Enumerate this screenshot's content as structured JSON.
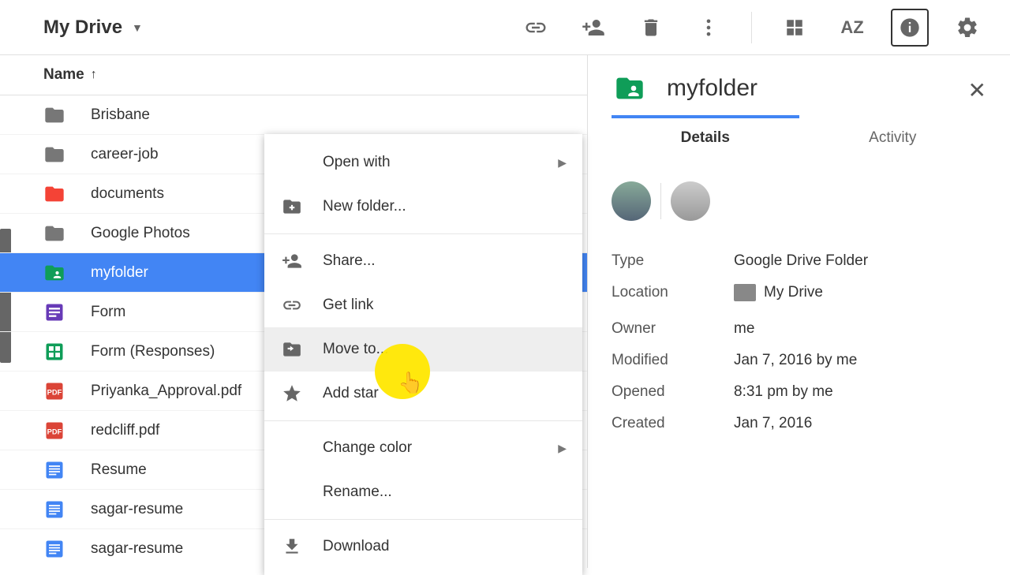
{
  "toolbar": {
    "breadcrumb": "My Drive"
  },
  "list": {
    "sort_column": "Name",
    "files": [
      {
        "name": "Brisbane",
        "type": "folder",
        "color": "#777"
      },
      {
        "name": "career-job",
        "type": "folder",
        "color": "#777"
      },
      {
        "name": "documents",
        "type": "folder",
        "color": "#f44336"
      },
      {
        "name": "Google Photos",
        "type": "folder",
        "color": "#777"
      },
      {
        "name": "myfolder",
        "type": "folder-shared",
        "color": "#0f9d58",
        "selected": true
      },
      {
        "name": "Form",
        "type": "form",
        "color": "#673ab7"
      },
      {
        "name": "Form (Responses)",
        "type": "sheet",
        "color": "#0f9d58"
      },
      {
        "name": "Priyanka_Approval.pdf",
        "type": "pdf",
        "color": "#db4437"
      },
      {
        "name": "redcliff.pdf",
        "type": "pdf",
        "color": "#db4437"
      },
      {
        "name": "Resume",
        "type": "doc",
        "color": "#4285f4"
      },
      {
        "name": "sagar-resume",
        "type": "doc",
        "color": "#4285f4",
        "shared": true
      },
      {
        "name": "sagar-resume",
        "type": "doc",
        "color": "#4285f4"
      }
    ]
  },
  "context_menu": {
    "open_with": "Open with",
    "new_folder": "New folder...",
    "share": "Share...",
    "get_link": "Get link",
    "move_to": "Move to...",
    "add_star": "Add star",
    "change_color": "Change color",
    "rename": "Rename...",
    "download": "Download"
  },
  "details": {
    "title": "myfolder",
    "tabs": {
      "details": "Details",
      "activity": "Activity"
    },
    "type_label": "Type",
    "type_value": "Google Drive Folder",
    "location_label": "Location",
    "location_value": "My Drive",
    "owner_label": "Owner",
    "owner_value": "me",
    "modified_label": "Modified",
    "modified_value": "Jan 7, 2016 by me",
    "opened_label": "Opened",
    "opened_value": "8:31 pm by me",
    "created_label": "Created",
    "created_value": "Jan 7, 2016"
  }
}
